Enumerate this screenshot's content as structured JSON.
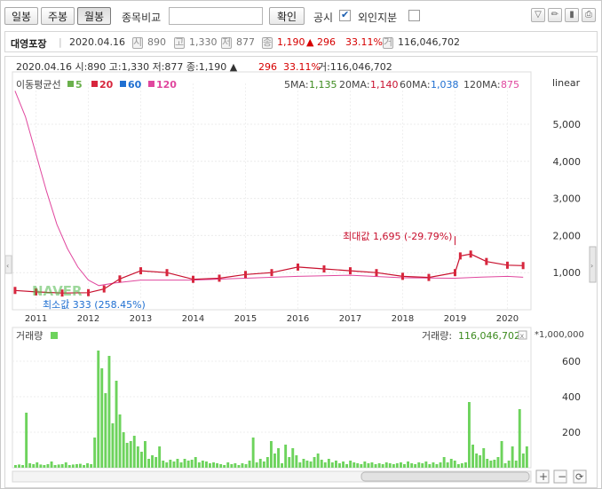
{
  "toolbar": {
    "daily": "일봉",
    "weekly": "주봉",
    "monthly": "월봉",
    "compare_label": "종목비교",
    "compare_value": "",
    "confirm": "확인",
    "disclosure": "공시",
    "foreign": "외인지분"
  },
  "stock": {
    "name": "대영포장",
    "date": "2020.04.16",
    "open": "890",
    "high": "1,330",
    "low": "877",
    "close": "1,190",
    "change": "▲ 296",
    "pct": "33.11%",
    "volume": "116,046,702"
  },
  "chart_header": {
    "line": "2020.04.16 시:890 고:1,330 저:877 종:1,190 ▲",
    "change": "296",
    "pct": "33.11%",
    "vol": "거:116,046,702",
    "ma_title": "이동평균선",
    "ma_legend": [
      {
        "period": "5",
        "color": "#6ab04c"
      },
      {
        "period": "20",
        "color": "#d7263d"
      },
      {
        "period": "60",
        "color": "#1f6fd1"
      },
      {
        "period": "120",
        "color": "#e0479e"
      }
    ],
    "ma_values": [
      {
        "label": "5MA:",
        "value": "1,135",
        "color": "#3d8b1f"
      },
      {
        "label": "20MA:",
        "value": "1,140",
        "color": "#c8102e"
      },
      {
        "label": "60MA:",
        "value": "1,038",
        "color": "#1f6fd1"
      },
      {
        "label": "120MA:",
        "value": "875",
        "color": "#e0479e"
      }
    ],
    "scale": "linear"
  },
  "annotations": {
    "max": "최대값 1,695 (-29.79%)",
    "min": "최소값 333 (258.45%)",
    "watermark": "NAVER"
  },
  "volume_header": {
    "title": "거래량",
    "label": "거래량:",
    "value": "116,046,702",
    "unit": "*1,000,000"
  },
  "chart_data": [
    {
      "type": "line",
      "title": "대영포장",
      "x_ticks": [
        "2011",
        "2012",
        "2013",
        "2014",
        "2015",
        "2016",
        "2017",
        "2018",
        "2019",
        "2020"
      ],
      "y_ticks": [
        1000,
        2000,
        3000,
        4000,
        5000
      ],
      "y_tick_labels": [
        "1,000",
        "2,000",
        "3,000",
        "4,000",
        "5,000"
      ],
      "ylim": [
        0,
        6100
      ],
      "scale": "linear",
      "series": [
        {
          "name": "120",
          "x": [
            2010.6,
            2010.8,
            2011.0,
            2011.2,
            2011.4,
            2011.6,
            2011.8,
            2012.0,
            2012.2,
            2012.5,
            2013.0,
            2014.0,
            2015.0,
            2016.0,
            2017.0,
            2018.0,
            2019.0,
            2019.5,
            2020.0,
            2020.3
          ],
          "values": [
            5900,
            5200,
            4200,
            3200,
            2300,
            1650,
            1150,
            800,
            650,
            720,
            800,
            800,
            850,
            900,
            930,
            860,
            850,
            880,
            900,
            875
          ]
        },
        {
          "name": "price",
          "x": [
            2010.6,
            2011.0,
            2011.5,
            2012.0,
            2012.3,
            2012.6,
            2013.0,
            2013.5,
            2014.0,
            2014.5,
            2015.0,
            2015.5,
            2016.0,
            2016.5,
            2017.0,
            2017.5,
            2018.0,
            2018.5,
            2019.0,
            2019.1,
            2019.3,
            2019.6,
            2020.0,
            2020.3
          ],
          "values": [
            520,
            480,
            450,
            460,
            560,
            830,
            1050,
            1000,
            820,
            850,
            950,
            1000,
            1150,
            1100,
            1050,
            1000,
            900,
            870,
            1000,
            1450,
            1500,
            1300,
            1200,
            1190
          ]
        }
      ],
      "markers": [
        {
          "label": "최대값 1,695 (-29.79%)",
          "x": 2019.0,
          "y": 1695
        },
        {
          "label": "최소값 333 (258.45%)",
          "x": 2011.6,
          "y": 333
        }
      ]
    },
    {
      "type": "bar",
      "title": "거래량",
      "unit": "*1,000,000",
      "y_ticks": [
        200,
        400,
        600
      ],
      "ylim": [
        0,
        690
      ],
      "values": [
        15,
        18,
        15,
        310,
        25,
        20,
        30,
        18,
        15,
        20,
        35,
        15,
        18,
        20,
        30,
        15,
        18,
        20,
        22,
        15,
        25,
        20,
        170,
        660,
        560,
        420,
        630,
        250,
        490,
        300,
        200,
        140,
        150,
        180,
        120,
        90,
        150,
        50,
        70,
        60,
        120,
        40,
        30,
        45,
        35,
        50,
        30,
        50,
        40,
        45,
        60,
        30,
        40,
        35,
        25,
        30,
        25,
        20,
        15,
        30,
        20,
        25,
        15,
        25,
        20,
        40,
        170,
        30,
        50,
        35,
        60,
        150,
        80,
        110,
        25,
        130,
        60,
        110,
        70,
        30,
        50,
        40,
        35,
        60,
        80,
        45,
        30,
        50,
        30,
        40,
        25,
        35,
        20,
        40,
        30,
        25,
        20,
        35,
        25,
        30,
        20,
        25,
        20,
        30,
        25,
        20,
        25,
        30,
        20,
        35,
        25,
        20,
        30,
        25,
        35,
        20,
        30,
        20,
        30,
        60,
        30,
        50,
        40,
        20,
        25,
        30,
        370,
        130,
        80,
        70,
        110,
        50,
        40,
        45,
        60,
        150,
        25,
        40,
        120,
        40,
        330,
        80,
        120
      ]
    }
  ]
}
